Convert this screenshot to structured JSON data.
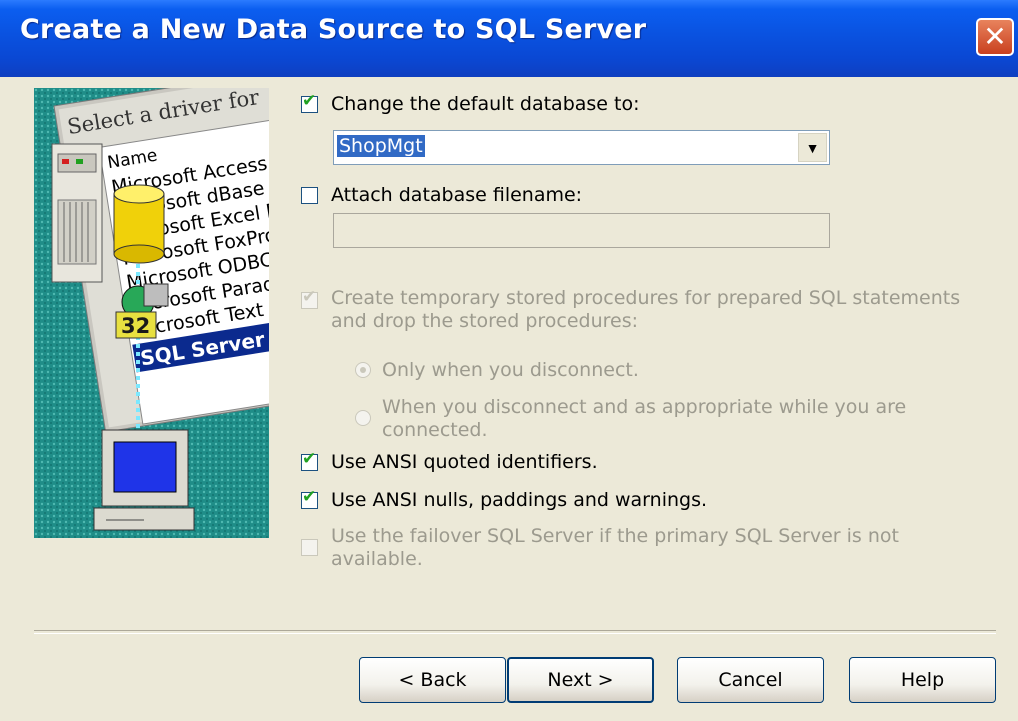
{
  "window": {
    "title": "Create a New Data Source to SQL Server",
    "close_glyph": "✕"
  },
  "art": {
    "select_text": "Select a driver for",
    "name_header": "Name",
    "drivers": [
      "Microsoft Access D",
      "Microsoft dBase D",
      "Microsoft Excel D",
      "Microsoft FoxPro",
      "Microsoft ODBC",
      "Microsoft Paradox",
      "Microsoft Text",
      "SQL Server"
    ],
    "badge": "32"
  },
  "options": {
    "change_db": {
      "label": "Change the default database to:",
      "checked": true,
      "enabled": true
    },
    "default_db_value": "ShopMgt",
    "attach_db": {
      "label": "Attach database filename:",
      "checked": false,
      "enabled": true
    },
    "attach_value": "",
    "temp_procs": {
      "line1": "Create temporary stored procedures for prepared SQL statements",
      "line2": "and drop the stored procedures:",
      "checked": true,
      "enabled": false
    },
    "only_disconnect": {
      "label": "Only when you disconnect.",
      "selected": true,
      "enabled": false
    },
    "when_disconnect": {
      "line1": "When you disconnect and as appropriate while you are",
      "line2": "connected.",
      "selected": false,
      "enabled": false
    },
    "ansi_quoted": {
      "label": "Use ANSI quoted identifiers.",
      "checked": true,
      "enabled": true
    },
    "ansi_nulls": {
      "label": "Use ANSI nulls, paddings and warnings.",
      "checked": true,
      "enabled": true
    },
    "failover": {
      "line1": "Use the failover SQL Server if the primary SQL Server is not",
      "line2": "available.",
      "checked": false,
      "enabled": false
    }
  },
  "buttons": {
    "back": "< Back",
    "next": "Next >",
    "cancel": "Cancel",
    "help": "Help"
  },
  "colors": {
    "title_bar": "#0a52e0",
    "dialog_bg": "#ece9d8",
    "check_mark": "#21a121",
    "close_button": "#c9401f"
  }
}
